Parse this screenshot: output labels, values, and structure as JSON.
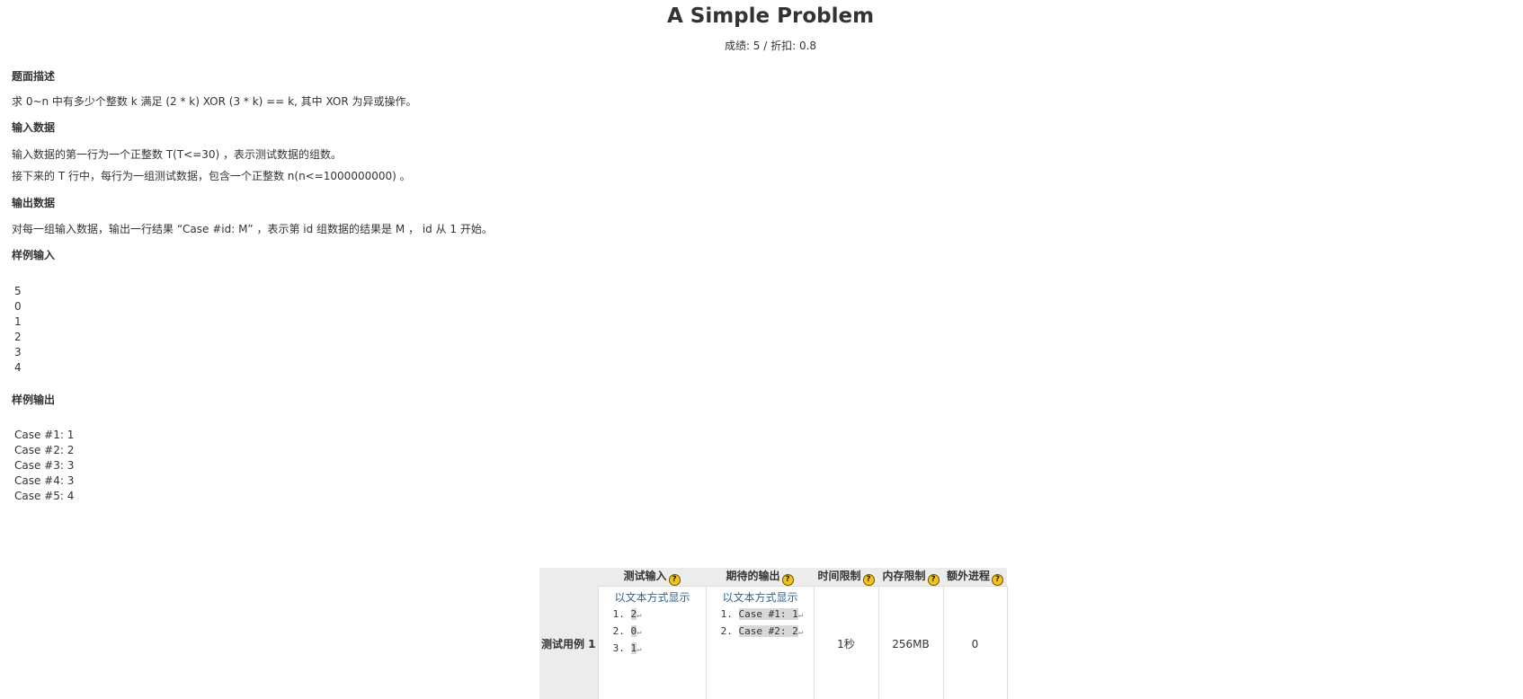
{
  "problem": {
    "title": "A Simple Problem",
    "grade_line": "成绩: 5 / 折扣: 0.8"
  },
  "sections": {
    "description": {
      "heading": "题面描述",
      "lines": [
        "求 0~n 中有多少个整数 k 满足 (2 * k) XOR (3 * k) == k, 其中 XOR 为异或操作。"
      ]
    },
    "input": {
      "heading": "输入数据",
      "lines": [
        "输入数据的第一行为一个正整数 T(T<=30) ，表示测试数据的组数。",
        "接下来的 T 行中，每行为一组测试数据，包含一个正整数 n(n<=1000000000) 。"
      ]
    },
    "output": {
      "heading": "输出数据",
      "lines": [
        "对每一组输入数据，输出一行结果 “Case #id: M” ，表示第 id 组数据的结果是 M ， id 从 1 开始。"
      ]
    },
    "sample_input": {
      "heading": "样例输入",
      "lines": [
        "5",
        "0",
        "1",
        "2",
        "3",
        "4"
      ]
    },
    "sample_output": {
      "heading": "样例输出",
      "lines": [
        "Case #1: 1",
        "Case #2: 2",
        "Case #3: 3",
        "Case #4: 3",
        "Case #5: 4"
      ]
    }
  },
  "test_table": {
    "headers": {
      "input": "测试输入",
      "expected": "期待的输出",
      "time": "时间限制",
      "memory": "内存限制",
      "process": "额外进程"
    },
    "help_glyph": "?",
    "row_label": "测试用例 1",
    "show_as_text": "以文本方式显示",
    "input_lines": [
      "2",
      "0",
      "1"
    ],
    "expected_lines": [
      "Case #1: 1",
      "Case #2: 2"
    ],
    "return_glyph": "↵",
    "time_limit": "1秒",
    "memory_limit": "256MB",
    "extra_process": "0"
  }
}
